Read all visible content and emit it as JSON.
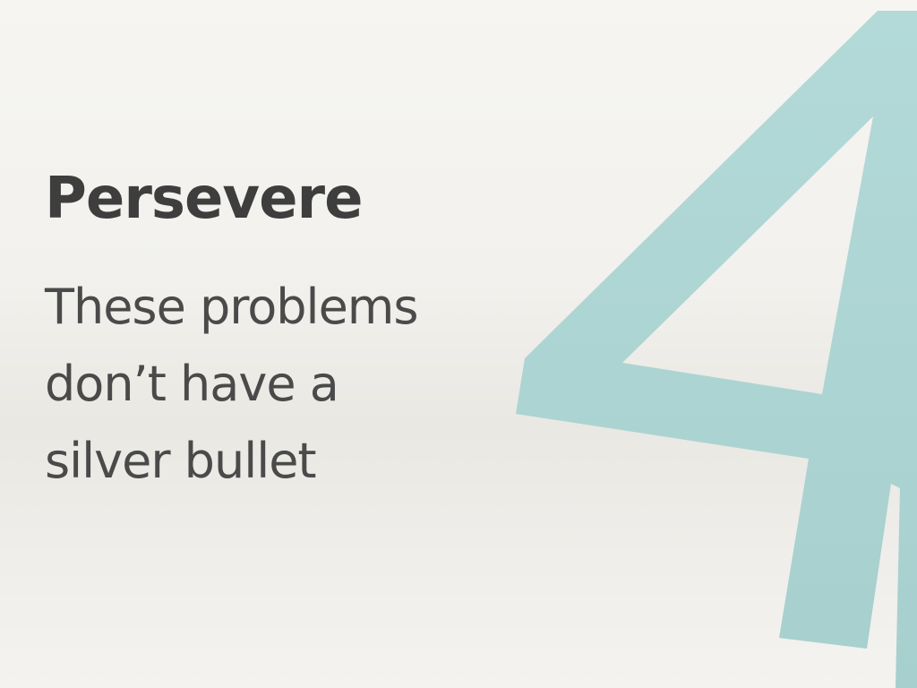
{
  "slide": {
    "number": "4",
    "title": "Persevere",
    "body_lines": [
      "These problems",
      "don’t have a",
      "silver bullet"
    ]
  },
  "colors": {
    "background": "#f3f2ee",
    "title_text": "#3e3e3e",
    "body_text": "#4a4a4a",
    "numeral": "#a9d3d2"
  }
}
